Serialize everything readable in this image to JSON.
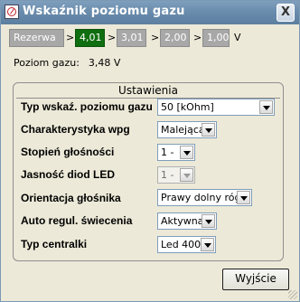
{
  "window": {
    "title": "Wskaźnik poziomu gazu",
    "close_label": "X"
  },
  "levels": {
    "items": [
      "Rezerwa",
      "4,01",
      "3,01",
      "2,00",
      "1,00"
    ],
    "separator": ">",
    "active": "4,01",
    "unit": "V"
  },
  "status": {
    "label": "Poziom gazu:",
    "value": "3,48",
    "unit": "V"
  },
  "settings": {
    "title": "Ustawienia",
    "rows": [
      {
        "label": "Typ wskaź. poziomu gazu",
        "value": "50 [kOhm]",
        "enabled": true
      },
      {
        "label": "Charakterystyka wpg",
        "value": "Malejąca",
        "enabled": true
      },
      {
        "label": "Stopień głośności",
        "value": "1 -",
        "enabled": true
      },
      {
        "label": "Jasność diod LED",
        "value": "1 -",
        "enabled": false
      },
      {
        "label": "Orientacja głośnika",
        "value": "Prawy dolny róg",
        "enabled": true
      },
      {
        "label": "Auto regul. świecenia",
        "value": "Aktywna",
        "enabled": true
      },
      {
        "label": "Typ centralki",
        "value": "Led 400",
        "enabled": true
      }
    ]
  },
  "buttons": {
    "exit_label": "Wyjście"
  },
  "colors": {
    "active_level": "#0f6e0f",
    "inactive_level": "#a8a8a8",
    "title_bar": "#6a8cad"
  },
  "icons": {
    "app": "gauge-icon",
    "close": "close-icon",
    "dropdown": "chevron-down-icon"
  }
}
